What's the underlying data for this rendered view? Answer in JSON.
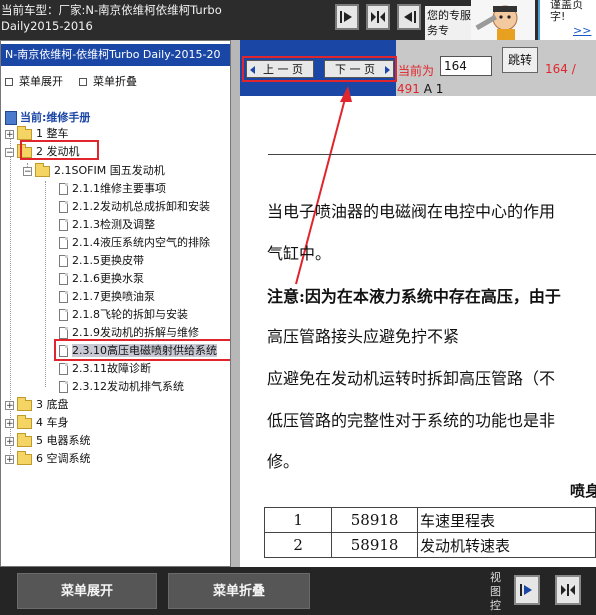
{
  "topbar": {
    "vehicle_label": "当前车型：厂家:N-南京依维柯依维柯Turbo Daily2015-2016",
    "service_text": "您的专服务专",
    "promo_line1": "谨盖页",
    "promo_line2": "字!",
    "promo_link": ">>第"
  },
  "left_panel": {
    "header": "N-南京依维柯-依维柯Turbo Daily-2015-20",
    "expand_all": "菜单展开",
    "collapse_all": "菜单折叠",
    "current": "当前:维修手册",
    "tree": [
      {
        "label": "1 整车",
        "level": 0
      },
      {
        "label": "2 发动机",
        "level": 0
      },
      {
        "label": "2.1SOFIM 国五发动机",
        "level": 1
      },
      {
        "label": "2.1.1维修主要事项",
        "level": 2
      },
      {
        "label": "2.1.2发动机总成拆卸和安装",
        "level": 2
      },
      {
        "label": "2.1.3检测及调整",
        "level": 2
      },
      {
        "label": "2.1.4液压系统内空气的排除",
        "level": 2
      },
      {
        "label": "2.1.5更换皮带",
        "level": 2
      },
      {
        "label": "2.1.6更换水泵",
        "level": 2
      },
      {
        "label": "2.1.7更换喷油泵",
        "level": 2
      },
      {
        "label": "2.1.8飞轮的拆卸与安装",
        "level": 2
      },
      {
        "label": "2.1.9发动机的拆解与维修",
        "level": 2
      },
      {
        "label": "2.3.10高压电磁喷射供给系统",
        "level": 2
      },
      {
        "label": "2.3.11故障诊断",
        "level": 2
      },
      {
        "label": "2.3.12发动机排气系统",
        "level": 2
      },
      {
        "label": "3 底盘",
        "level": 0
      },
      {
        "label": "4 车身",
        "level": 0
      },
      {
        "label": "5 电器系统",
        "level": 0
      },
      {
        "label": "6 空调系统",
        "level": 0
      }
    ]
  },
  "toolbar": {
    "prev": "上 一 页",
    "next": "下 一 页",
    "current_label": "当前为",
    "page_value": "164",
    "jump": "跳转",
    "count_top": "164 /",
    "count_num": "491",
    "count_suffix": " A 1"
  },
  "document": {
    "line1": "当电子喷油器的电磁阀在电控中心的作用",
    "line2": "气缸中。",
    "line3": "注意:因为在本液力系统中存在高压，由于",
    "line4": "高压管路接头应避免拧不紧",
    "line5": "应避免在发动机运转时拆卸高压管路（不",
    "line6": "低压管路的完整性对于系统的功能也是非",
    "line7": "修。",
    "table_caption": "喷身",
    "table_rows": [
      {
        "no": "1",
        "code": "58918",
        "name": "车速里程表"
      },
      {
        "no": "2",
        "code": "58918",
        "name": "发动机转速表"
      }
    ]
  },
  "bottombar": {
    "expand": "菜单展开",
    "collapse": "菜单折叠",
    "view_label": "视图控"
  }
}
